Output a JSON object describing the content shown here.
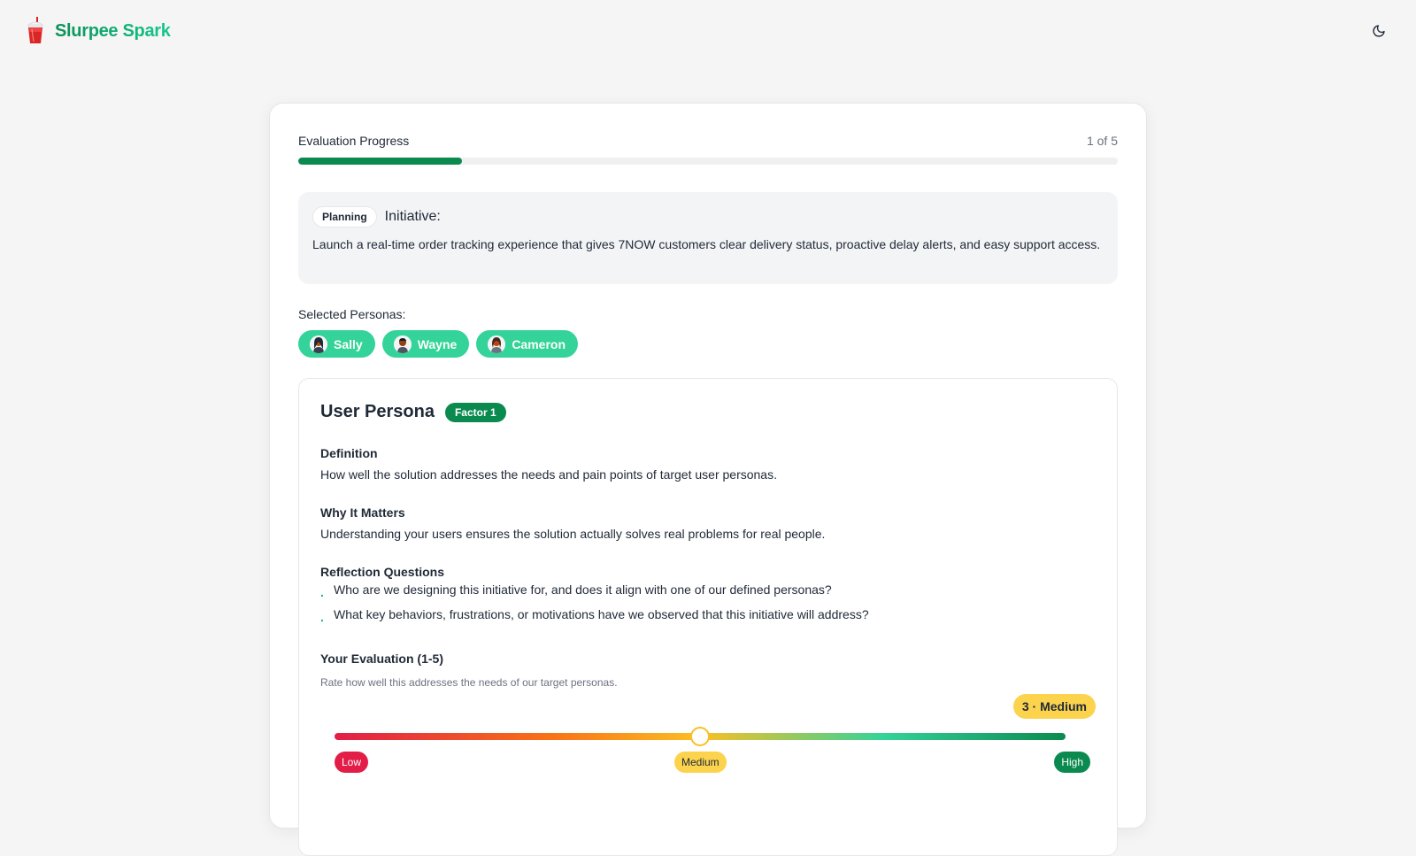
{
  "header": {
    "brand_name": "Slurpee Spark",
    "logo_icon": "slurpee-cup-icon",
    "theme_icon": "moon-icon"
  },
  "progress": {
    "label": "Evaluation Progress",
    "count_text": "1 of 5",
    "current": 1,
    "total": 5,
    "fill_color": "#0b8a4f"
  },
  "initiative": {
    "stage": "Planning",
    "title": "Initiative:",
    "description": "Launch a real-time order tracking experience that gives 7NOW customers clear delivery status, proactive delay alerts, and easy support access."
  },
  "personas": {
    "label": "Selected Personas:",
    "items": [
      {
        "name": "Sally"
      },
      {
        "name": "Wayne"
      },
      {
        "name": "Cameron"
      }
    ]
  },
  "factor": {
    "title": "User Persona",
    "badge": "Factor 1",
    "definition_title": "Definition",
    "definition_text": "How well the solution addresses the needs and pain points of target user personas.",
    "why_title": "Why It Matters",
    "why_text": "Understanding your users ensures the solution actually solves real problems for real people.",
    "questions_title": "Reflection Questions",
    "questions": [
      "Who are we designing this initiative for, and does it align with one of our defined personas?",
      "What key behaviors, frustrations, or motivations have we observed that this initiative will address?"
    ]
  },
  "evaluation": {
    "title": "Your Evaluation (1-5)",
    "hint": "Rate how well this addresses the needs of our target personas.",
    "score_text": "3 · Medium",
    "value": 3,
    "min": 1,
    "max": 5,
    "low_label": "Low",
    "medium_label": "Medium",
    "high_label": "High"
  },
  "colors": {
    "accent": "#0b8a4f",
    "persona_chip": "#34d399",
    "medium": "#fcd34d",
    "low": "#e11d48"
  }
}
